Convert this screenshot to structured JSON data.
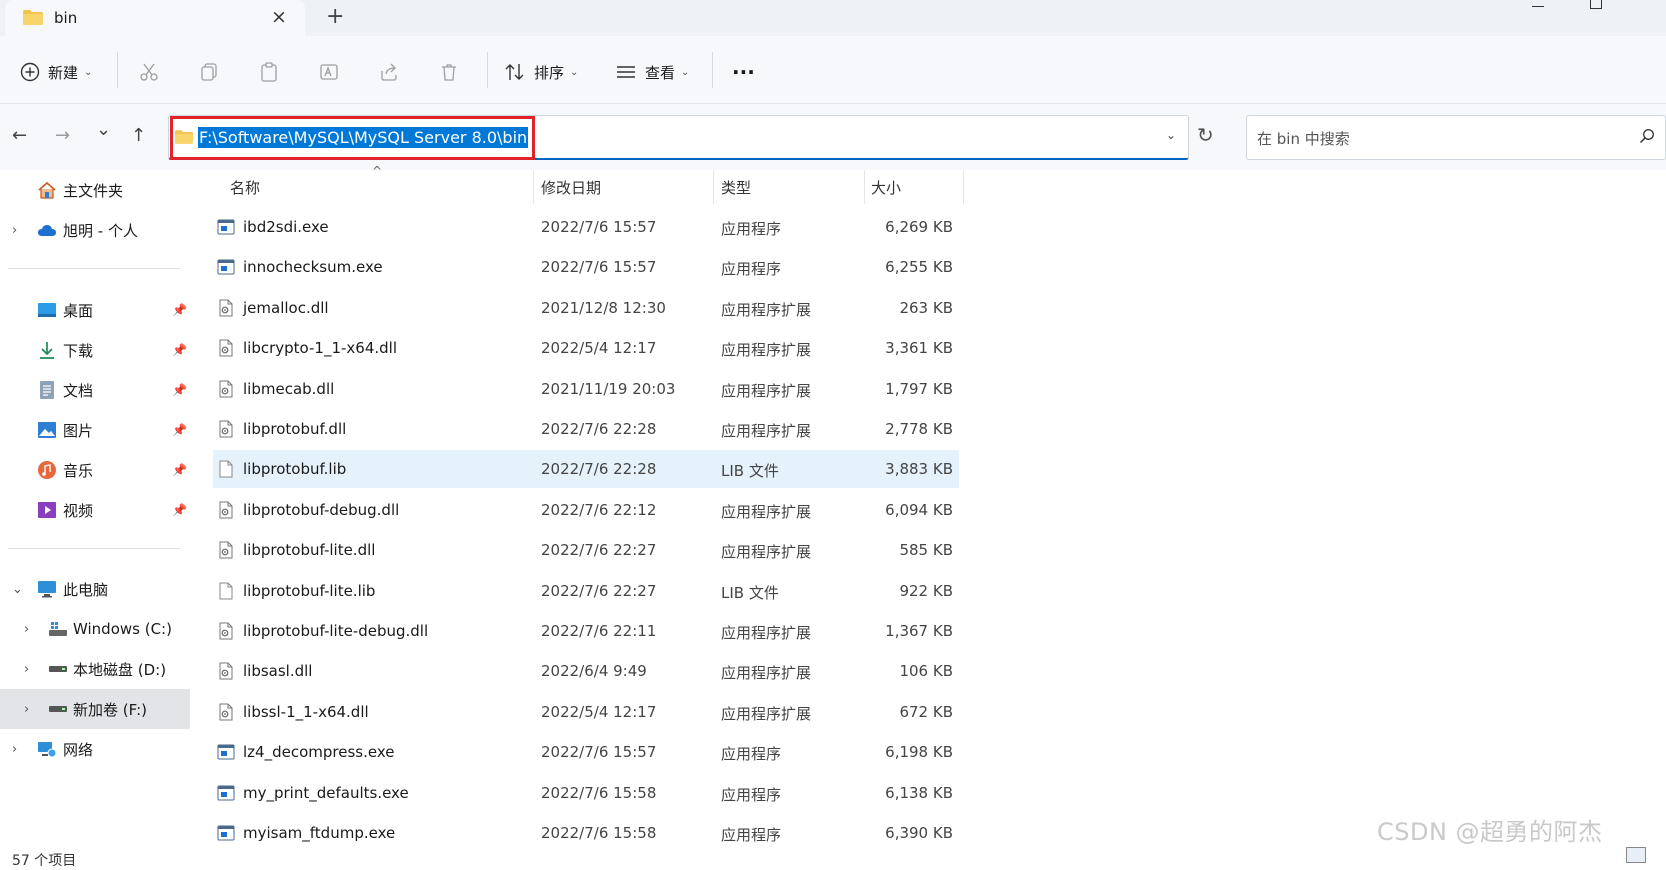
{
  "tab": {
    "title": "bin",
    "close": "×",
    "new": "+"
  },
  "toolbar": {
    "new_label": "新建",
    "sort_label": "排序",
    "view_label": "查看",
    "more": "···"
  },
  "nav": {
    "back": "←",
    "forward": "→",
    "recent": "⌄",
    "up": "↑",
    "address": "F:\\Software\\MySQL\\MySQL Server 8.0\\bin",
    "refresh": "↻",
    "search_placeholder": "在 bin 中搜索"
  },
  "sidebar": {
    "items": [
      {
        "label": "主文件夹",
        "icon": "home-icon"
      },
      {
        "label": "旭明 - 个人",
        "icon": "cloud-icon"
      },
      {
        "label": "桌面",
        "icon": "desktop-icon"
      },
      {
        "label": "下载",
        "icon": "download-icon"
      },
      {
        "label": "文档",
        "icon": "document-icon"
      },
      {
        "label": "图片",
        "icon": "pictures-icon"
      },
      {
        "label": "音乐",
        "icon": "music-icon"
      },
      {
        "label": "视频",
        "icon": "video-icon"
      },
      {
        "label": "此电脑",
        "icon": "computer-icon"
      },
      {
        "label": "Windows (C:)",
        "icon": "drive-icon"
      },
      {
        "label": "本地磁盘 (D:)",
        "icon": "drive-icon"
      },
      {
        "label": "新加卷 (F:)",
        "icon": "drive-icon"
      },
      {
        "label": "网络",
        "icon": "network-icon"
      }
    ]
  },
  "columns": {
    "name": "名称",
    "date": "修改日期",
    "type": "类型",
    "size": "大小"
  },
  "files": [
    {
      "name": "ibd2sdi.exe",
      "date": "2022/7/6 15:57",
      "type": "应用程序",
      "size": "6,269 KB",
      "kind": "exe"
    },
    {
      "name": "innochecksum.exe",
      "date": "2022/7/6 15:57",
      "type": "应用程序",
      "size": "6,255 KB",
      "kind": "exe"
    },
    {
      "name": "jemalloc.dll",
      "date": "2021/12/8 12:30",
      "type": "应用程序扩展",
      "size": "263 KB",
      "kind": "dll"
    },
    {
      "name": "libcrypto-1_1-x64.dll",
      "date": "2022/5/4 12:17",
      "type": "应用程序扩展",
      "size": "3,361 KB",
      "kind": "dll"
    },
    {
      "name": "libmecab.dll",
      "date": "2021/11/19 20:03",
      "type": "应用程序扩展",
      "size": "1,797 KB",
      "kind": "dll"
    },
    {
      "name": "libprotobuf.dll",
      "date": "2022/7/6 22:28",
      "type": "应用程序扩展",
      "size": "2,778 KB",
      "kind": "dll"
    },
    {
      "name": "libprotobuf.lib",
      "date": "2022/7/6 22:28",
      "type": "LIB 文件",
      "size": "3,883 KB",
      "kind": "lib"
    },
    {
      "name": "libprotobuf-debug.dll",
      "date": "2022/7/6 22:12",
      "type": "应用程序扩展",
      "size": "6,094 KB",
      "kind": "dll"
    },
    {
      "name": "libprotobuf-lite.dll",
      "date": "2022/7/6 22:27",
      "type": "应用程序扩展",
      "size": "585 KB",
      "kind": "dll"
    },
    {
      "name": "libprotobuf-lite.lib",
      "date": "2022/7/6 22:27",
      "type": "LIB 文件",
      "size": "922 KB",
      "kind": "lib"
    },
    {
      "name": "libprotobuf-lite-debug.dll",
      "date": "2022/7/6 22:11",
      "type": "应用程序扩展",
      "size": "1,367 KB",
      "kind": "dll"
    },
    {
      "name": "libsasl.dll",
      "date": "2022/6/4 9:49",
      "type": "应用程序扩展",
      "size": "106 KB",
      "kind": "dll"
    },
    {
      "name": "libssl-1_1-x64.dll",
      "date": "2022/5/4 12:17",
      "type": "应用程序扩展",
      "size": "672 KB",
      "kind": "dll"
    },
    {
      "name": "lz4_decompress.exe",
      "date": "2022/7/6 15:57",
      "type": "应用程序",
      "size": "6,198 KB",
      "kind": "exe"
    },
    {
      "name": "my_print_defaults.exe",
      "date": "2022/7/6 15:58",
      "type": "应用程序",
      "size": "6,138 KB",
      "kind": "exe"
    },
    {
      "name": "myisam_ftdump.exe",
      "date": "2022/7/6 15:58",
      "type": "应用程序",
      "size": "6,390 KB",
      "kind": "exe"
    }
  ],
  "status": {
    "count": "57 个项目"
  },
  "watermark": "CSDN @超勇的阿杰",
  "colors": {
    "accent": "#0078d7",
    "highlight_box": "#e0242b",
    "selected_row": "#e5f1fb"
  }
}
